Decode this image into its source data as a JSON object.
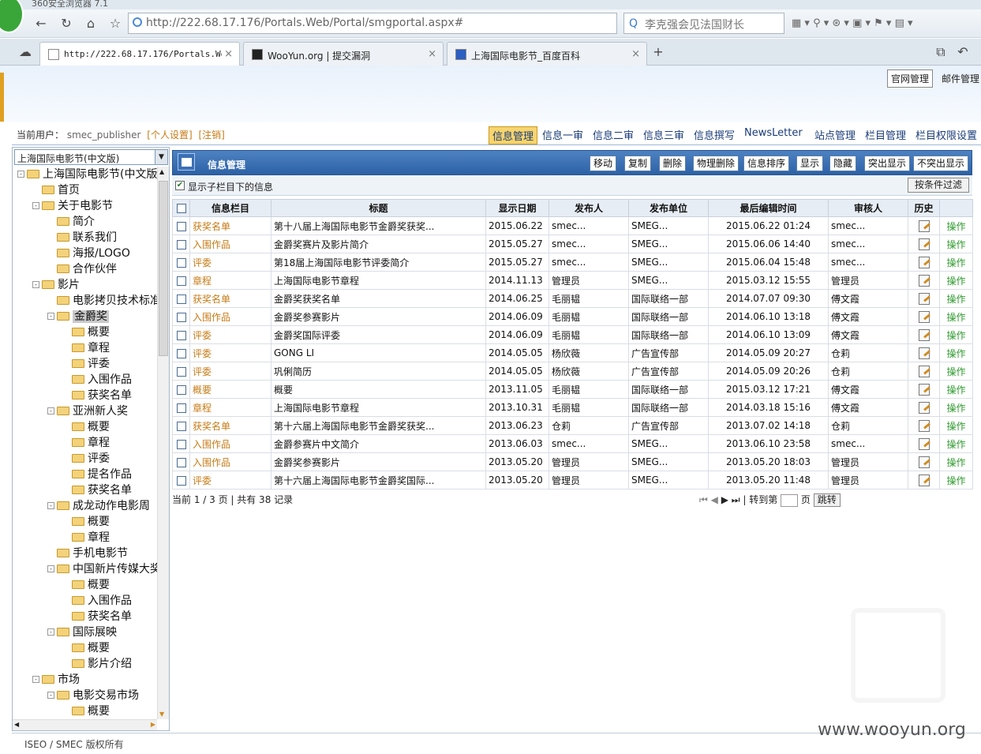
{
  "browser": {
    "title_partial": "360安全浏览器 7.1",
    "url": "http://222.68.17.176/Portals.Web/Portal/smgportal.aspx#",
    "search_text": "李克强会见法国财长",
    "tabs": [
      {
        "label": "http://222.68.17.176/Portals.Web/Po",
        "active": true
      },
      {
        "label": "WooYun.org | 提交漏洞",
        "active": false
      },
      {
        "label": "上海国际电影节_百度百科",
        "active": false
      }
    ]
  },
  "top_links": {
    "site_admin": "官网管理",
    "mail_admin": "邮件管理"
  },
  "userbar": {
    "current_user_label": "当前用户：",
    "username": "smec_publisher",
    "personal_settings": "[个人设置]",
    "logout": "[注销]",
    "menu": [
      "信息管理",
      "信息一审",
      "信息二审",
      "信息三审",
      "信息撰写",
      "NewsLetter",
      "站点管理",
      "栏目管理",
      "栏目权限设置"
    ]
  },
  "sidebar": {
    "site_select": "上海国际电影节(中文版)",
    "tree": [
      {
        "label": "上海国际电影节(中文版",
        "level": 0,
        "pm": "-"
      },
      {
        "label": "首页",
        "level": 1
      },
      {
        "label": "关于电影节",
        "level": 1,
        "pm": "-"
      },
      {
        "label": "简介",
        "level": 2
      },
      {
        "label": "联系我们",
        "level": 2
      },
      {
        "label": "海报/LOGO",
        "level": 2
      },
      {
        "label": "合作伙伴",
        "level": 2
      },
      {
        "label": "影片",
        "level": 1,
        "pm": "-"
      },
      {
        "label": "电影拷贝技术标准",
        "level": 2
      },
      {
        "label": "金爵奖",
        "level": 2,
        "pm": "-",
        "selected": true
      },
      {
        "label": "概要",
        "level": 3
      },
      {
        "label": "章程",
        "level": 3
      },
      {
        "label": "评委",
        "level": 3
      },
      {
        "label": "入围作品",
        "level": 3
      },
      {
        "label": "获奖名单",
        "level": 3
      },
      {
        "label": "亚洲新人奖",
        "level": 2,
        "pm": "-"
      },
      {
        "label": "概要",
        "level": 3
      },
      {
        "label": "章程",
        "level": 3
      },
      {
        "label": "评委",
        "level": 3
      },
      {
        "label": "提名作品",
        "level": 3
      },
      {
        "label": "获奖名单",
        "level": 3
      },
      {
        "label": "成龙动作电影周",
        "level": 2,
        "pm": "-"
      },
      {
        "label": "概要",
        "level": 3
      },
      {
        "label": "章程",
        "level": 3
      },
      {
        "label": "手机电影节",
        "level": 2
      },
      {
        "label": "中国新片传媒大奖",
        "level": 2,
        "pm": "-"
      },
      {
        "label": "概要",
        "level": 3
      },
      {
        "label": "入围作品",
        "level": 3
      },
      {
        "label": "获奖名单",
        "level": 3
      },
      {
        "label": "国际展映",
        "level": 2,
        "pm": "-"
      },
      {
        "label": "概要",
        "level": 3
      },
      {
        "label": "影片介绍",
        "level": 3
      },
      {
        "label": "市场",
        "level": 1,
        "pm": "-"
      },
      {
        "label": "电影交易市场",
        "level": 2,
        "pm": "-"
      },
      {
        "label": "概要",
        "level": 3
      }
    ]
  },
  "panel": {
    "title": "信息管理",
    "buttons": [
      "移动",
      "复制",
      "删除",
      "物理删除",
      "信息排序",
      "显示",
      "隐藏",
      "突出显示",
      "不突出显示"
    ],
    "show_sub_label": "显示子栏目下的信息",
    "filter_button": "按条件过滤"
  },
  "table": {
    "headers": [
      "信息栏目",
      "标题",
      "显示日期",
      "发布人",
      "发布单位",
      "最后编辑时间",
      "审核人",
      "历史"
    ],
    "op_label": "操作",
    "rows": [
      [
        "获奖名单",
        "第十八届上海国际电影节金爵奖获奖...",
        "2015.06.22",
        "smec...",
        "SMEG...",
        "2015.06.22 01:24",
        "smec..."
      ],
      [
        "入围作品",
        "金爵奖赛片及影片简介",
        "2015.05.27",
        "smec...",
        "SMEG...",
        "2015.06.06 14:40",
        "smec..."
      ],
      [
        "评委",
        "第18届上海国际电影节评委简介",
        "2015.05.27",
        "smec...",
        "SMEG...",
        "2015.06.04 15:48",
        "smec..."
      ],
      [
        "章程",
        "上海国际电影节章程",
        "2014.11.13",
        "管理员",
        "SMEG...",
        "2015.03.12 15:55",
        "管理员"
      ],
      [
        "获奖名单",
        "金爵奖获奖名单",
        "2014.06.25",
        "毛丽韫",
        "国际联络一部",
        "2014.07.07 09:30",
        "傅文霞"
      ],
      [
        "入围作品",
        "金爵奖参赛影片",
        "2014.06.09",
        "毛丽韫",
        "国际联络一部",
        "2014.06.10 13:18",
        "傅文霞"
      ],
      [
        "评委",
        "金爵奖国际评委",
        "2014.06.09",
        "毛丽韫",
        "国际联络一部",
        "2014.06.10 13:09",
        "傅文霞"
      ],
      [
        "评委",
        "GONG LI",
        "2014.05.05",
        "杨欣薇",
        "广告宣传部",
        "2014.05.09 20:27",
        "仓莉"
      ],
      [
        "评委",
        "巩俐简历",
        "2014.05.05",
        "杨欣薇",
        "广告宣传部",
        "2014.05.09 20:26",
        "仓莉"
      ],
      [
        "概要",
        "概要",
        "2013.11.05",
        "毛丽韫",
        "国际联络一部",
        "2015.03.12 17:21",
        "傅文霞"
      ],
      [
        "章程",
        "上海国际电影节章程",
        "2013.10.31",
        "毛丽韫",
        "国际联络一部",
        "2014.03.18 15:16",
        "傅文霞"
      ],
      [
        "获奖名单",
        "第十六届上海国际电影节金爵奖获奖...",
        "2013.06.23",
        "仓莉",
        "广告宣传部",
        "2013.07.02 14:18",
        "仓莉"
      ],
      [
        "入围作品",
        "金爵参赛片中文简介",
        "2013.06.03",
        "smec...",
        "SMEG...",
        "2013.06.10 23:58",
        "smec..."
      ],
      [
        "入围作品",
        "金爵奖参赛影片",
        "2013.05.20",
        "管理员",
        "SMEG...",
        "2013.05.20 18:03",
        "管理员"
      ],
      [
        "评委",
        "第十六届上海国际电影节金爵奖国际...",
        "2013.05.20",
        "管理员",
        "SMEG...",
        "2013.05.20 11:48",
        "管理员"
      ]
    ]
  },
  "pager": {
    "info": "当前 1 / 3 页 | 共有 38 记录",
    "goto_label": "| 转到第",
    "page_unit": "页",
    "go_button": "跳转"
  },
  "footer": {
    "text": "ISEO / SMEC 版权所有"
  },
  "watermark": "www.wooyun.org"
}
